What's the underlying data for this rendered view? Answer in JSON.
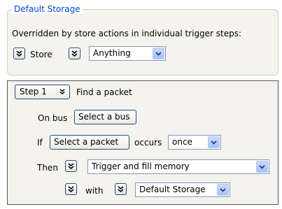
{
  "default_storage": {
    "legend": "Default Storage",
    "description": "Overridden by store actions in individual trigger steps:",
    "store_label": "Store",
    "store_value": "Anything"
  },
  "step": {
    "step_select": "Step 1",
    "find_label": "Find a packet",
    "on_bus_label": "On bus",
    "select_bus_label": "Select a bus",
    "if_label": "If",
    "select_packet_label": "Select a packet",
    "occurs_label": "occurs",
    "occurs_value": "once",
    "then_label": "Then",
    "then_action": "Trigger and fill memory",
    "with_label": "with",
    "with_value": "Default Storage"
  },
  "icons": {
    "chevron": "double-chevron-down-icon",
    "dropdown": "dropdown-arrow-icon"
  },
  "colors": {
    "legend": "#0046d5",
    "button_border": "#1c5180",
    "combo_border": "#7f9db9",
    "panel_bg": "#f4f3ee"
  }
}
